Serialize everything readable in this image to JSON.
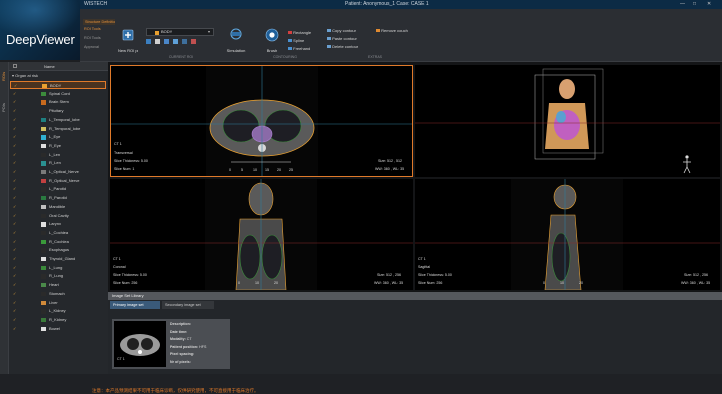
{
  "titlebar": {
    "app": "WISTECH",
    "patient_info": "Patient: Anonymous_1   Case: CASE 1"
  },
  "window_controls": {
    "minimize": "—",
    "maximize": "□",
    "close": "✕"
  },
  "logo": {
    "text": "DeepViewer"
  },
  "tabs": [
    {
      "label": "Patient Data Management",
      "active": false
    },
    {
      "label": "Tumor Modeling",
      "active": true
    }
  ],
  "subtab": {
    "label": "Structure Definition"
  },
  "side_menu": {
    "items": [
      "ROI Tools",
      "ROI Tools",
      "Approval"
    ]
  },
  "toolbar": {
    "new_roi": "New ROI property",
    "roi_selector": "BODY",
    "roi_color": "#e8a030",
    "simulation": "Simulation",
    "brush": "Brush",
    "rectangle": "Rectangle",
    "spline": "Spline",
    "freehand": "Freehand",
    "copy": "Copy contour",
    "paste": "Paste contour",
    "delete": "Delete contour",
    "remove_couch": "Remove couch",
    "group_labels": [
      "CURRENT ROI",
      "CONTOURING",
      "EXTRAS"
    ]
  },
  "side_tabs": [
    "ROIs",
    "POIs"
  ],
  "roi_header": {
    "name": "Name",
    "group": "Organ at risk"
  },
  "rois": [
    {
      "name": "BODY",
      "color": "#e8a030",
      "selected": true
    },
    {
      "name": "Spinal Cord",
      "color": "#3c8b3c"
    },
    {
      "name": "Brain Stem",
      "color": "#c76a1e"
    },
    {
      "name": "Pituitary",
      "color": "#2a2a2a"
    },
    {
      "name": "L_Temporal_lobe",
      "color": "#1e8080"
    },
    {
      "name": "R_Temporal_lobe",
      "color": "#d0c060"
    },
    {
      "name": "L_Eye",
      "color": "#30b0d0"
    },
    {
      "name": "R_Eye",
      "color": "#e0e0e0"
    },
    {
      "name": "L_Len",
      "color": "#2a2a2a"
    },
    {
      "name": "R_Len",
      "color": "#2a9090"
    },
    {
      "name": "L_Optical_Nerve",
      "color": "#7a7a7a"
    },
    {
      "name": "R_Optical_Nerve",
      "color": "#c24040"
    },
    {
      "name": "L_Parotid",
      "color": "#2a2a2a"
    },
    {
      "name": "R_Parotid",
      "color": "#2a7a40"
    },
    {
      "name": "Mandible",
      "color": "#c0c0c0"
    },
    {
      "name": "Oral Cavity",
      "color": "#2a2a2a"
    },
    {
      "name": "Larynx",
      "color": "#e0e0e0"
    },
    {
      "name": "L_Cochlea",
      "color": "#2a2a2a"
    },
    {
      "name": "R_Cochlea",
      "color": "#3a9a3a"
    },
    {
      "name": "Esophagus",
      "color": "#2a2a2a"
    },
    {
      "name": "Thyroid_Gland",
      "color": "#e0e0e0"
    },
    {
      "name": "L_Lung",
      "color": "#3a8a3a"
    },
    {
      "name": "R_Lung",
      "color": "#2a2a2a"
    },
    {
      "name": "Heart",
      "color": "#4a8a4a"
    },
    {
      "name": "Stomach",
      "color": "#2a2a2a"
    },
    {
      "name": "Liver",
      "color": "#d08a3a"
    },
    {
      "name": "L_Kidney",
      "color": "#2a2a2a"
    },
    {
      "name": "R_Kidney",
      "color": "#3a7a3a"
    },
    {
      "name": "Bowel",
      "color": "#e0e0e0"
    }
  ],
  "viewports": {
    "transverse": {
      "ct": "CT 1",
      "orientation": "Transversal",
      "slice_thickness": "Slice Thickness: 5.00",
      "slice_num": "Slice Num: 1",
      "size": "Size: 512 , 512",
      "ww": "WW: 360 , WL: 35",
      "ruler": [
        "0",
        "5",
        "10",
        "15",
        "20",
        "25"
      ]
    },
    "coronal": {
      "ct": "CT 1",
      "orientation": "Coronal",
      "slice_thickness": "Slice Thickness: 5.00",
      "slice_num": "Slice Num: 256",
      "size": "Size: 512 , 256",
      "ww": "WW: 360 , WL: 35",
      "ruler": [
        "0",
        "10",
        "20"
      ]
    },
    "sagittal": {
      "ct": "CT 1",
      "orientation": "Sagittal",
      "slice_thickness": "Slice Thickness: 5.00",
      "slice_num": "Slice Num: 256",
      "size": "Size: 512 , 256",
      "ww": "WW: 360 , WL: 35",
      "ruler": [
        "0",
        "10",
        "20"
      ]
    }
  },
  "image_library": {
    "title": "Image Set Library",
    "tabs": [
      "Primary image set",
      "Secondary image set"
    ],
    "thumb_label": "CT 1",
    "fields": [
      {
        "label": "Description:",
        "value": ""
      },
      {
        "label": "Date time:",
        "value": ""
      },
      {
        "label": "Modality:",
        "value": "CT"
      },
      {
        "label": "Patient position:",
        "value": "HFS"
      },
      {
        "label": "Pixel spacing:",
        "value": ""
      },
      {
        "label": "Nr of pixels:",
        "value": ""
      }
    ]
  },
  "footer": {
    "notice": "注意：本产品预测结果不可用于临床诊断，仅供研究使用，不可直接用于临床治疗。"
  }
}
